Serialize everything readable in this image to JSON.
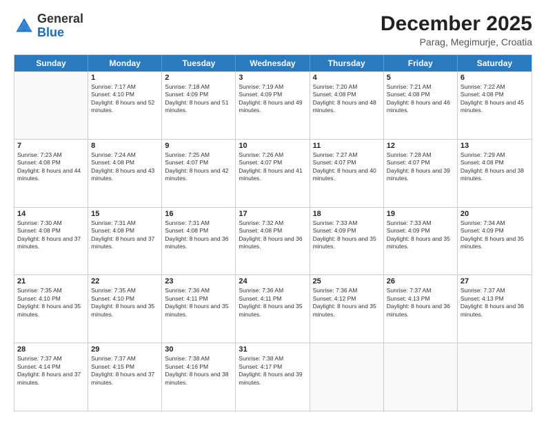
{
  "header": {
    "logo_general": "General",
    "logo_blue": "Blue",
    "month_title": "December 2025",
    "location": "Parag, Megimurje, Croatia"
  },
  "weekdays": [
    "Sunday",
    "Monday",
    "Tuesday",
    "Wednesday",
    "Thursday",
    "Friday",
    "Saturday"
  ],
  "rows": [
    [
      {
        "day": "",
        "empty": true
      },
      {
        "day": "1",
        "sunrise": "7:17 AM",
        "sunset": "4:10 PM",
        "daylight": "8 hours and 52 minutes."
      },
      {
        "day": "2",
        "sunrise": "7:18 AM",
        "sunset": "4:09 PM",
        "daylight": "8 hours and 51 minutes."
      },
      {
        "day": "3",
        "sunrise": "7:19 AM",
        "sunset": "4:09 PM",
        "daylight": "8 hours and 49 minutes."
      },
      {
        "day": "4",
        "sunrise": "7:20 AM",
        "sunset": "4:08 PM",
        "daylight": "8 hours and 48 minutes."
      },
      {
        "day": "5",
        "sunrise": "7:21 AM",
        "sunset": "4:08 PM",
        "daylight": "8 hours and 46 minutes."
      },
      {
        "day": "6",
        "sunrise": "7:22 AM",
        "sunset": "4:08 PM",
        "daylight": "8 hours and 45 minutes."
      }
    ],
    [
      {
        "day": "7",
        "sunrise": "7:23 AM",
        "sunset": "4:08 PM",
        "daylight": "8 hours and 44 minutes."
      },
      {
        "day": "8",
        "sunrise": "7:24 AM",
        "sunset": "4:08 PM",
        "daylight": "8 hours and 43 minutes."
      },
      {
        "day": "9",
        "sunrise": "7:25 AM",
        "sunset": "4:07 PM",
        "daylight": "8 hours and 42 minutes."
      },
      {
        "day": "10",
        "sunrise": "7:26 AM",
        "sunset": "4:07 PM",
        "daylight": "8 hours and 41 minutes."
      },
      {
        "day": "11",
        "sunrise": "7:27 AM",
        "sunset": "4:07 PM",
        "daylight": "8 hours and 40 minutes."
      },
      {
        "day": "12",
        "sunrise": "7:28 AM",
        "sunset": "4:07 PM",
        "daylight": "8 hours and 39 minutes."
      },
      {
        "day": "13",
        "sunrise": "7:29 AM",
        "sunset": "4:08 PM",
        "daylight": "8 hours and 38 minutes."
      }
    ],
    [
      {
        "day": "14",
        "sunrise": "7:30 AM",
        "sunset": "4:08 PM",
        "daylight": "8 hours and 37 minutes."
      },
      {
        "day": "15",
        "sunrise": "7:31 AM",
        "sunset": "4:08 PM",
        "daylight": "8 hours and 37 minutes."
      },
      {
        "day": "16",
        "sunrise": "7:31 AM",
        "sunset": "4:08 PM",
        "daylight": "8 hours and 36 minutes."
      },
      {
        "day": "17",
        "sunrise": "7:32 AM",
        "sunset": "4:08 PM",
        "daylight": "8 hours and 36 minutes."
      },
      {
        "day": "18",
        "sunrise": "7:33 AM",
        "sunset": "4:09 PM",
        "daylight": "8 hours and 35 minutes."
      },
      {
        "day": "19",
        "sunrise": "7:33 AM",
        "sunset": "4:09 PM",
        "daylight": "8 hours and 35 minutes."
      },
      {
        "day": "20",
        "sunrise": "7:34 AM",
        "sunset": "4:09 PM",
        "daylight": "8 hours and 35 minutes."
      }
    ],
    [
      {
        "day": "21",
        "sunrise": "7:35 AM",
        "sunset": "4:10 PM",
        "daylight": "8 hours and 35 minutes."
      },
      {
        "day": "22",
        "sunrise": "7:35 AM",
        "sunset": "4:10 PM",
        "daylight": "8 hours and 35 minutes."
      },
      {
        "day": "23",
        "sunrise": "7:36 AM",
        "sunset": "4:11 PM",
        "daylight": "8 hours and 35 minutes."
      },
      {
        "day": "24",
        "sunrise": "7:36 AM",
        "sunset": "4:11 PM",
        "daylight": "8 hours and 35 minutes."
      },
      {
        "day": "25",
        "sunrise": "7:36 AM",
        "sunset": "4:12 PM",
        "daylight": "8 hours and 35 minutes."
      },
      {
        "day": "26",
        "sunrise": "7:37 AM",
        "sunset": "4:13 PM",
        "daylight": "8 hours and 36 minutes."
      },
      {
        "day": "27",
        "sunrise": "7:37 AM",
        "sunset": "4:13 PM",
        "daylight": "8 hours and 36 minutes."
      }
    ],
    [
      {
        "day": "28",
        "sunrise": "7:37 AM",
        "sunset": "4:14 PM",
        "daylight": "8 hours and 37 minutes."
      },
      {
        "day": "29",
        "sunrise": "7:37 AM",
        "sunset": "4:15 PM",
        "daylight": "8 hours and 37 minutes."
      },
      {
        "day": "30",
        "sunrise": "7:38 AM",
        "sunset": "4:16 PM",
        "daylight": "8 hours and 38 minutes."
      },
      {
        "day": "31",
        "sunrise": "7:38 AM",
        "sunset": "4:17 PM",
        "daylight": "8 hours and 39 minutes."
      },
      {
        "day": "",
        "empty": true
      },
      {
        "day": "",
        "empty": true
      },
      {
        "day": "",
        "empty": true
      }
    ]
  ]
}
